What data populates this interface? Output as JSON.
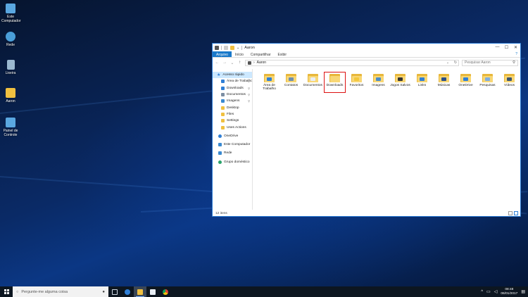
{
  "desktop": {
    "icons": [
      {
        "label": "Este Computador",
        "icon": "computer-icon",
        "color": "#5aa7e0"
      },
      {
        "label": "Rede",
        "icon": "network-icon",
        "color": "#4a9ed8"
      },
      {
        "label": "Lixeira",
        "icon": "recycle-bin-icon",
        "color": "#9ab8d0"
      },
      {
        "label": "Aaron",
        "icon": "user-folder-icon",
        "color": "#f0c040"
      },
      {
        "label": "Painel de Controle",
        "icon": "control-panel-icon",
        "color": "#5aa7e0"
      }
    ]
  },
  "window": {
    "title": "Aaron",
    "controls": {
      "minimize": "—",
      "maximize": "☐",
      "close": "✕"
    },
    "ribbon": {
      "file_tab": "Arquivo",
      "tabs": [
        "Início",
        "Compartilhar",
        "Exibir"
      ],
      "help": "?"
    },
    "address": {
      "back": "←",
      "forward": "→",
      "recent": "⌄",
      "up": "↑",
      "separator": "›",
      "path": "Aaron",
      "dropdown": "⌄",
      "refresh": "↻"
    },
    "search": {
      "placeholder": "Pesquisar Aaron",
      "icon": "search-icon"
    },
    "nav_pane": {
      "quick_access": {
        "label": "Acesso rápido",
        "icon": "star-icon"
      },
      "quick_items": [
        {
          "label": "Área de Trabalho",
          "icon": "desktop-icon",
          "color": "#2f7fd6",
          "pinned": true
        },
        {
          "label": "Downloads",
          "icon": "download-icon",
          "color": "#2f7fd6",
          "pinned": true
        },
        {
          "label": "Documentos",
          "icon": "documents-icon",
          "color": "#7c8ea3",
          "pinned": true
        },
        {
          "label": "Imagens",
          "icon": "pictures-icon",
          "color": "#3a8ad1",
          "pinned": true
        },
        {
          "label": "Desktop",
          "icon": "folder-icon",
          "color": "#f0c040",
          "pinned": false
        },
        {
          "label": "Files",
          "icon": "folder-icon",
          "color": "#f0c040",
          "pinned": false
        },
        {
          "label": "Settings",
          "icon": "folder-icon",
          "color": "#f0c040",
          "pinned": false
        },
        {
          "label": "Uses Actions",
          "icon": "folder-icon",
          "color": "#f0c040",
          "pinned": false
        }
      ],
      "pin_glyph": "⚲",
      "onedrive": {
        "label": "OneDrive",
        "icon": "onedrive-icon",
        "color": "#2f7fd6"
      },
      "this_pc": {
        "label": "Este Computador",
        "icon": "computer-icon",
        "color": "#3a8ad1"
      },
      "network": {
        "label": "Rede",
        "icon": "network-icon",
        "color": "#3a8ad1"
      },
      "homegroup": {
        "label": "Grupo doméstico",
        "icon": "homegroup-icon",
        "color": "#2aa36b"
      }
    },
    "files": [
      {
        "name": "Área de Trabalho",
        "badge": "#2f7fd6",
        "selected": false
      },
      {
        "name": "Contatos",
        "badge": "#6d8fb0",
        "selected": false
      },
      {
        "name": "Documentos",
        "badge": "#e9eef5",
        "selected": false
      },
      {
        "name": "Downloads",
        "badge": "#f8d775",
        "selected": true
      },
      {
        "name": "Favoritos",
        "badge": "#f3c73a",
        "selected": false
      },
      {
        "name": "Imagens",
        "badge": "#4a8cc8",
        "selected": false
      },
      {
        "name": "Jogos Salvos",
        "badge": "#333333",
        "selected": false
      },
      {
        "name": "Links",
        "badge": "#2f7fd6",
        "selected": false
      },
      {
        "name": "Músicas",
        "badge": "#2a4f8a",
        "selected": false
      },
      {
        "name": "OneDrive",
        "badge": "#2f7fd6",
        "selected": false
      },
      {
        "name": "Pesquisas",
        "badge": "#7faee0",
        "selected": false
      },
      {
        "name": "Vídeos",
        "badge": "#3b5570",
        "selected": false
      }
    ],
    "status": "12 itens"
  },
  "taskbar": {
    "search_placeholder": "Pergunte-me alguma coisa",
    "search_icon": "○",
    "mic": "🎤",
    "apps": [
      {
        "icon": "task-view-icon",
        "color": "#cfd8e3"
      },
      {
        "icon": "edge-icon",
        "color": "#2f7fd6"
      },
      {
        "icon": "file-explorer-icon",
        "color": "#f0c040",
        "active": true
      },
      {
        "icon": "store-icon",
        "color": "#e8eef5"
      },
      {
        "icon": "chrome-icon",
        "color": "#e0b020"
      }
    ],
    "tray": {
      "chevron": "^",
      "network": "▭",
      "volume": "◁",
      "time": "08:48",
      "date": "06/01/2017",
      "notifications": "▤"
    }
  }
}
